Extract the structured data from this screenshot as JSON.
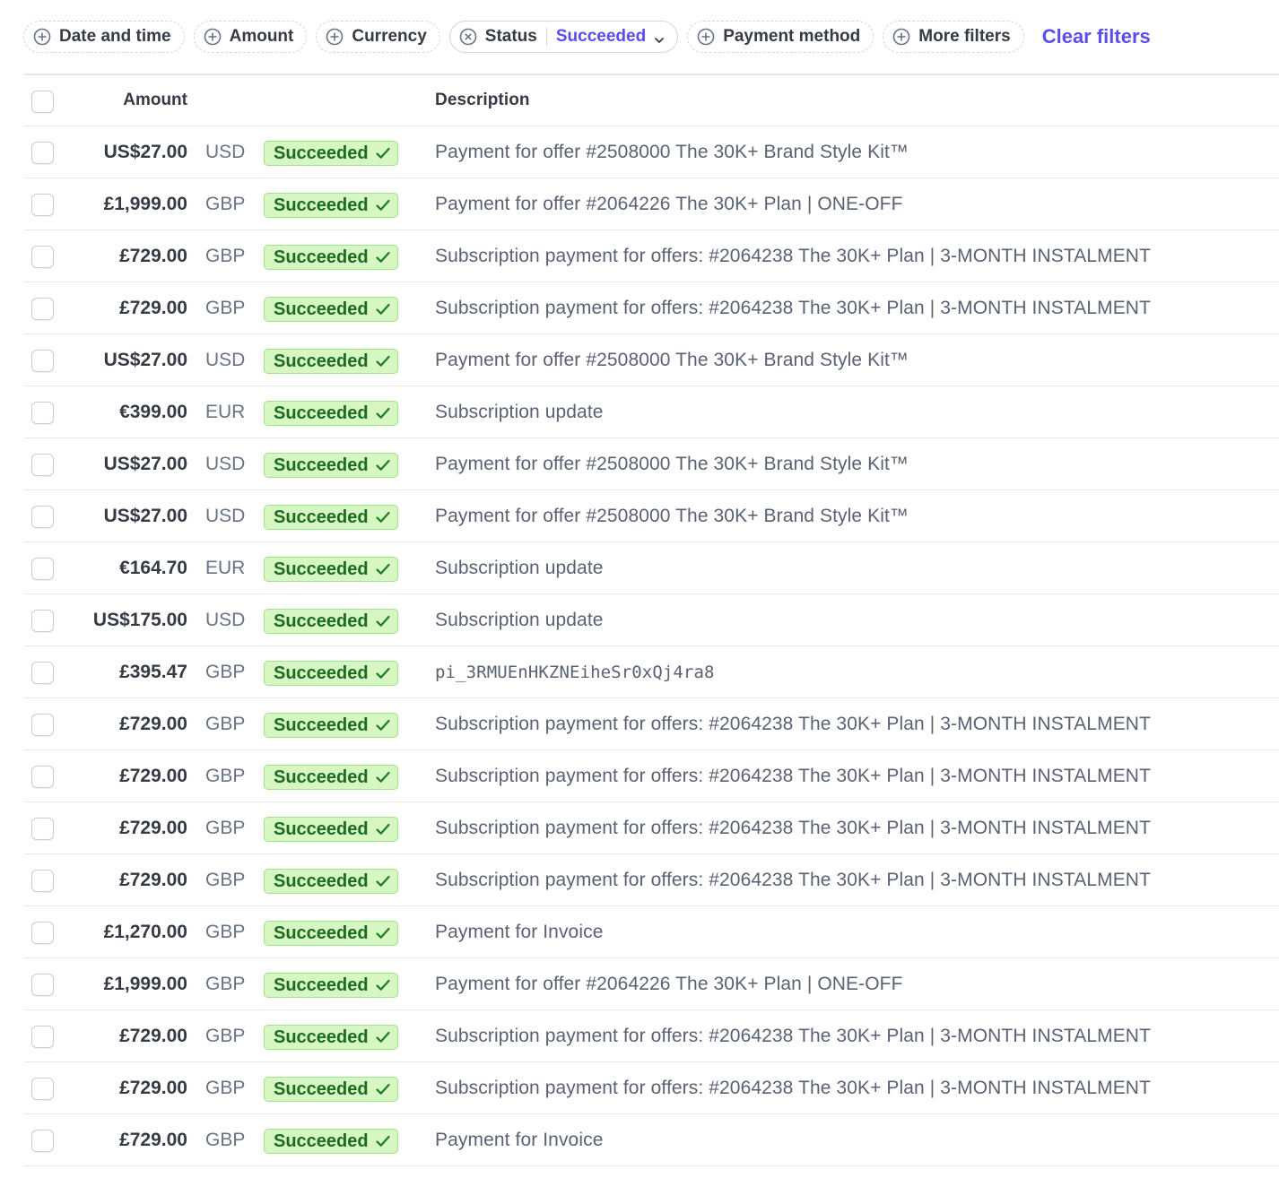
{
  "filters": {
    "date_and_time": "Date and time",
    "amount": "Amount",
    "currency": "Currency",
    "status": "Status",
    "status_value": "Succeeded",
    "payment_method": "Payment method",
    "more_filters": "More filters",
    "clear_filters": "Clear filters"
  },
  "table": {
    "headers": {
      "amount": "Amount",
      "description": "Description"
    },
    "rows": [
      {
        "amount": "US$27.00",
        "currency": "USD",
        "status": "Succeeded",
        "description": "Payment for offer #2508000 The 30K+ Brand Style Kit™"
      },
      {
        "amount": "£1,999.00",
        "currency": "GBP",
        "status": "Succeeded",
        "description": "Payment for offer #2064226 The 30K+ Plan | ONE-OFF"
      },
      {
        "amount": "£729.00",
        "currency": "GBP",
        "status": "Succeeded",
        "description": "Subscription payment for offers: #2064238 The 30K+ Plan | 3-MONTH INSTALMENT"
      },
      {
        "amount": "£729.00",
        "currency": "GBP",
        "status": "Succeeded",
        "description": "Subscription payment for offers: #2064238 The 30K+ Plan | 3-MONTH INSTALMENT"
      },
      {
        "amount": "US$27.00",
        "currency": "USD",
        "status": "Succeeded",
        "description": "Payment for offer #2508000 The 30K+ Brand Style Kit™"
      },
      {
        "amount": "€399.00",
        "currency": "EUR",
        "status": "Succeeded",
        "description": "Subscription update"
      },
      {
        "amount": "US$27.00",
        "currency": "USD",
        "status": "Succeeded",
        "description": "Payment for offer #2508000 The 30K+ Brand Style Kit™"
      },
      {
        "amount": "US$27.00",
        "currency": "USD",
        "status": "Succeeded",
        "description": "Payment for offer #2508000 The 30K+ Brand Style Kit™"
      },
      {
        "amount": "€164.70",
        "currency": "EUR",
        "status": "Succeeded",
        "description": "Subscription update"
      },
      {
        "amount": "US$175.00",
        "currency": "USD",
        "status": "Succeeded",
        "description": "Subscription update"
      },
      {
        "amount": "£395.47",
        "currency": "GBP",
        "status": "Succeeded",
        "description": "pi_3RMUEnHKZNEiheSr0xQj4ra8",
        "mono": true
      },
      {
        "amount": "£729.00",
        "currency": "GBP",
        "status": "Succeeded",
        "description": "Subscription payment for offers: #2064238 The 30K+ Plan | 3-MONTH INSTALMENT"
      },
      {
        "amount": "£729.00",
        "currency": "GBP",
        "status": "Succeeded",
        "description": "Subscription payment for offers: #2064238 The 30K+ Plan | 3-MONTH INSTALMENT"
      },
      {
        "amount": "£729.00",
        "currency": "GBP",
        "status": "Succeeded",
        "description": "Subscription payment for offers: #2064238 The 30K+ Plan | 3-MONTH INSTALMENT"
      },
      {
        "amount": "£729.00",
        "currency": "GBP",
        "status": "Succeeded",
        "description": "Subscription payment for offers: #2064238 The 30K+ Plan | 3-MONTH INSTALMENT"
      },
      {
        "amount": "£1,270.00",
        "currency": "GBP",
        "status": "Succeeded",
        "description": "Payment for Invoice"
      },
      {
        "amount": "£1,999.00",
        "currency": "GBP",
        "status": "Succeeded",
        "description": "Payment for offer #2064226 The 30K+ Plan | ONE-OFF"
      },
      {
        "amount": "£729.00",
        "currency": "GBP",
        "status": "Succeeded",
        "description": "Subscription payment for offers: #2064238 The 30K+ Plan | 3-MONTH INSTALMENT"
      },
      {
        "amount": "£729.00",
        "currency": "GBP",
        "status": "Succeeded",
        "description": "Subscription payment for offers: #2064238 The 30K+ Plan | 3-MONTH INSTALMENT"
      },
      {
        "amount": "£729.00",
        "currency": "GBP",
        "status": "Succeeded",
        "description": "Payment for Invoice"
      }
    ]
  },
  "colors": {
    "accent": "#5b4cf0",
    "success_bg": "#d7f7c2",
    "success_text": "#1c6b23"
  }
}
